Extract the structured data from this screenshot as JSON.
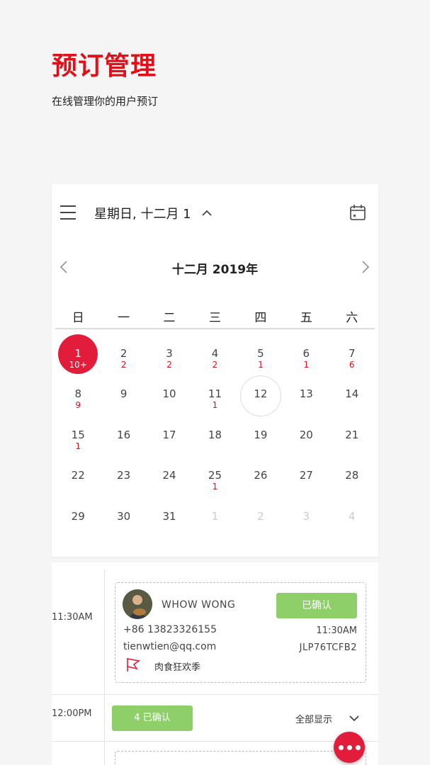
{
  "header": {
    "title": "预订管理",
    "subtitle": "在线管理你的用户预订"
  },
  "topbar": {
    "date_title": "星期日, 十二月 1"
  },
  "calendar": {
    "month_label": "十二月 2019年",
    "weekdays": [
      "日",
      "一",
      "二",
      "三",
      "四",
      "五",
      "六"
    ],
    "weeks": [
      [
        {
          "n": "1",
          "c": "10+"
        },
        {
          "n": "2",
          "c": "2"
        },
        {
          "n": "3",
          "c": "2"
        },
        {
          "n": "4",
          "c": "2"
        },
        {
          "n": "5",
          "c": "1"
        },
        {
          "n": "6",
          "c": "1"
        },
        {
          "n": "7",
          "c": "6"
        }
      ],
      [
        {
          "n": "8",
          "c": "9"
        },
        {
          "n": "9",
          "c": ""
        },
        {
          "n": "10",
          "c": ""
        },
        {
          "n": "11",
          "c": "1"
        },
        {
          "n": "12",
          "c": ""
        },
        {
          "n": "13",
          "c": ""
        },
        {
          "n": "14",
          "c": ""
        }
      ],
      [
        {
          "n": "15",
          "c": "1"
        },
        {
          "n": "16",
          "c": ""
        },
        {
          "n": "17",
          "c": ""
        },
        {
          "n": "18",
          "c": ""
        },
        {
          "n": "19",
          "c": ""
        },
        {
          "n": "20",
          "c": ""
        },
        {
          "n": "21",
          "c": ""
        }
      ],
      [
        {
          "n": "22",
          "c": ""
        },
        {
          "n": "23",
          "c": ""
        },
        {
          "n": "24",
          "c": ""
        },
        {
          "n": "25",
          "c": "1"
        },
        {
          "n": "26",
          "c": ""
        },
        {
          "n": "27",
          "c": ""
        },
        {
          "n": "28",
          "c": ""
        }
      ],
      [
        {
          "n": "29",
          "c": ""
        },
        {
          "n": "30",
          "c": ""
        },
        {
          "n": "31",
          "c": ""
        },
        {
          "n": "1",
          "c": "",
          "other": true
        },
        {
          "n": "2",
          "c": "",
          "other": true
        },
        {
          "n": "3",
          "c": "",
          "other": true
        },
        {
          "n": "4",
          "c": "",
          "other": true
        }
      ]
    ],
    "selected_day": "1",
    "today_day": "12"
  },
  "schedule": {
    "slot1_time": "11:30AM",
    "slot2_time": "12:00PM",
    "booking": {
      "name": "WHOW WONG",
      "status": "已确认",
      "phone": "+86 13823326155",
      "time": "11:30AM",
      "email": "tienwtien@qq.com",
      "code": "JLP76TCFB2",
      "event": "肉食狂欢季"
    },
    "count_button": "4 已确认",
    "show_all": "全部显示"
  },
  "colors": {
    "accent": "#e21d3b",
    "title_red": "#e0101a",
    "confirmed_green": "#8fcf6a"
  }
}
